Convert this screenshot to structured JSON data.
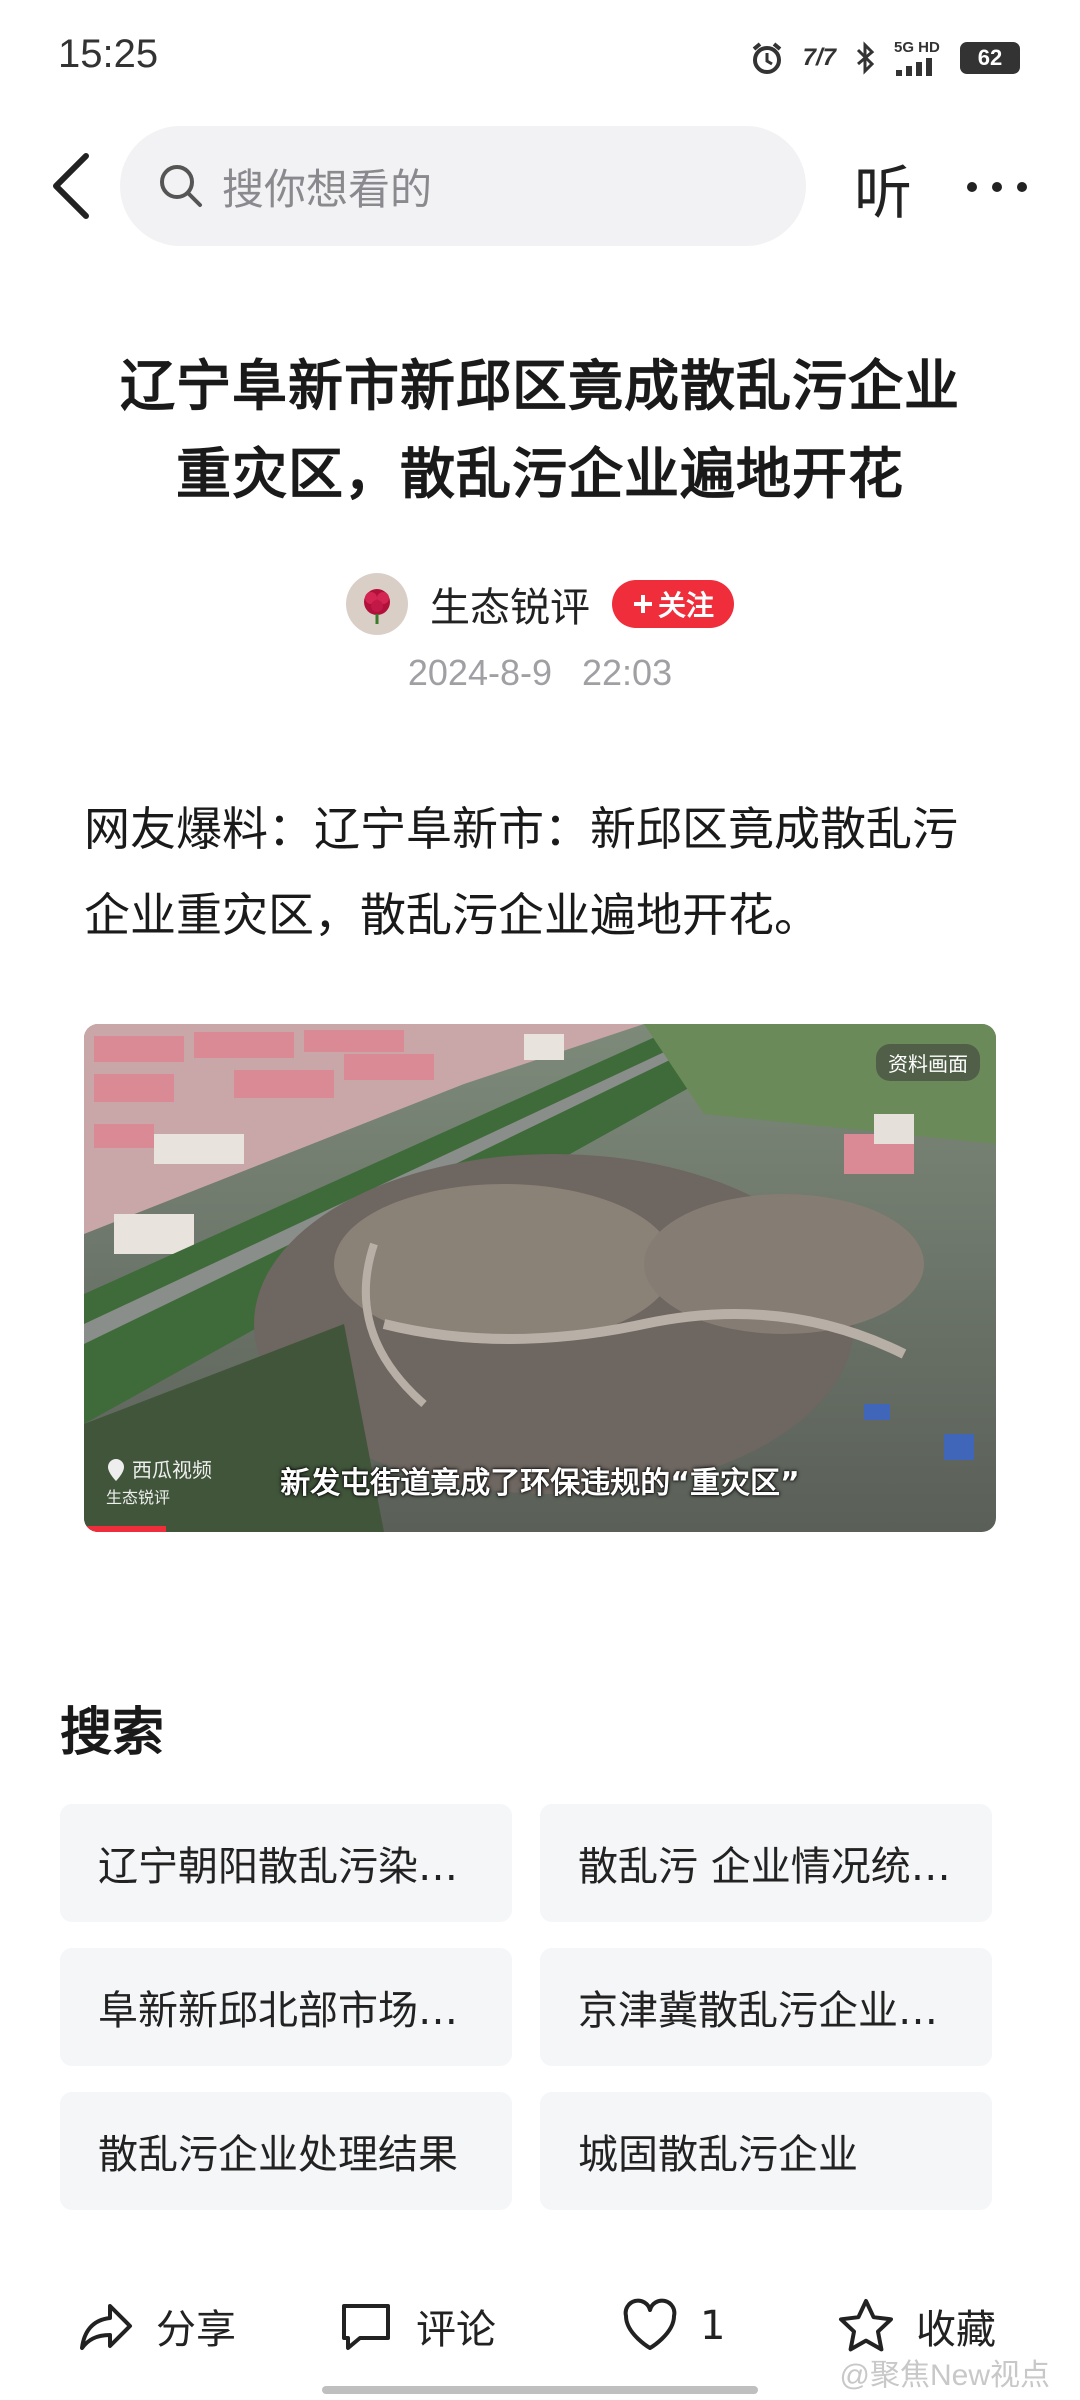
{
  "status_bar": {
    "time": "15:25",
    "network_label": "5G HD",
    "carrier_speed": "7/7",
    "battery": "62"
  },
  "nav": {
    "search_placeholder": "搜你想看的",
    "listen_label": "听"
  },
  "article": {
    "title_line1": "辽宁阜新市新邱区竟成散乱污企业",
    "title_line2": "重灾区，散乱污企业遍地开花",
    "author": "生态锐评",
    "follow_label": "关注",
    "date": "2024-8-9   22:03",
    "body_line1": "网友爆料：辽宁阜新市：新邱区竟成散乱污",
    "body_line2": "企业重灾区，散乱污企业遍地开花。"
  },
  "video": {
    "tag": "资料画面",
    "caption": "新发屯街道竟成了环保违规的“重灾区”",
    "watermark_brand": "西瓜视频",
    "watermark_author": "生态锐评",
    "progress_fraction": 0.09
  },
  "search_section": {
    "heading": "搜索",
    "chips": [
      "辽宁朝阳散乱污染…",
      "散乱污 企业情况统…",
      "阜新新邱北部市场…",
      "京津冀散乱污企业…",
      "散乱污企业处理结果",
      "城固散乱污企业"
    ]
  },
  "bottom_bar": {
    "share_label": "分享",
    "comment_label": "评论",
    "like_count": "1",
    "favorite_label": "收藏"
  },
  "watermark": "@聚焦New视点",
  "colors": {
    "accent_red": "#ef2d3b",
    "search_bg": "#f2f2f4",
    "chip_bg": "#f5f6f8"
  }
}
